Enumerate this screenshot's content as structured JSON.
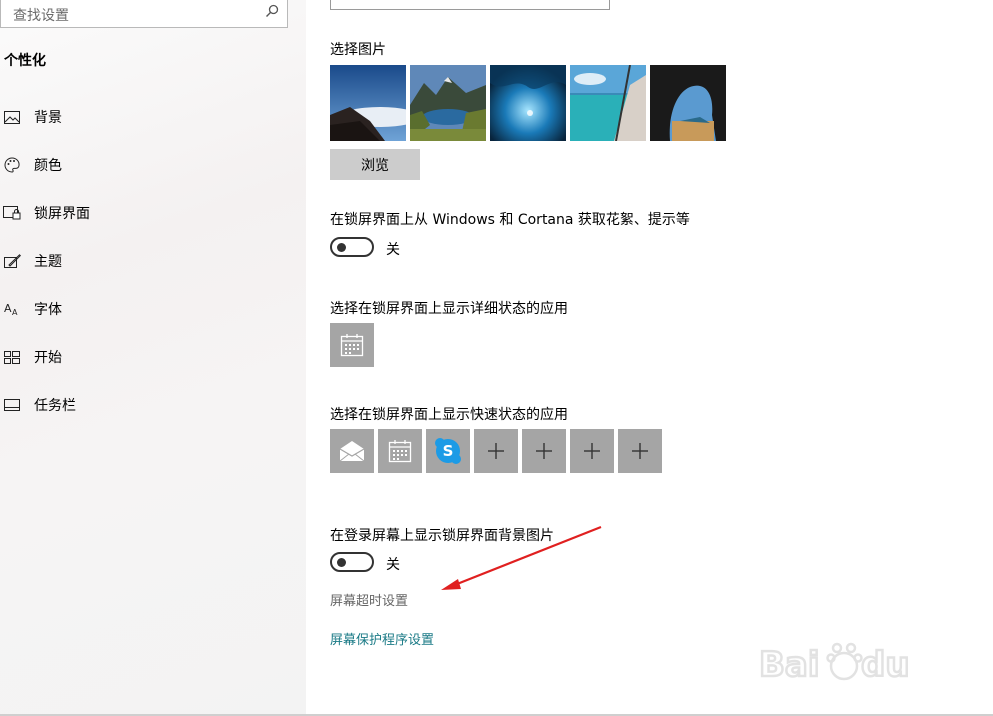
{
  "sidebar": {
    "search_placeholder": "查找设置",
    "section_title": "个性化",
    "items": [
      {
        "label": "背景",
        "icon": "picture-icon"
      },
      {
        "label": "颜色",
        "icon": "palette-icon"
      },
      {
        "label": "锁屏界面",
        "icon": "lock-screen-icon"
      },
      {
        "label": "主题",
        "icon": "theme-icon"
      },
      {
        "label": "字体",
        "icon": "font-icon"
      },
      {
        "label": "开始",
        "icon": "start-icon"
      },
      {
        "label": "任务栏",
        "icon": "taskbar-icon"
      }
    ]
  },
  "content": {
    "choose_picture_label": "选择图片",
    "browse_label": "浏览",
    "fun_facts_label": "在锁屏界面上从 Windows 和 Cortana 获取花絮、提示等",
    "fun_facts_toggle": "关",
    "detailed_status_label": "选择在锁屏界面上显示详细状态的应用",
    "quick_status_label": "选择在锁屏界面上显示快速状态的应用",
    "signin_bg_label": "在登录屏幕上显示锁屏界面背景图片",
    "signin_bg_toggle": "关",
    "screen_timeout_link": "屏幕超时设置",
    "screensaver_link": "屏幕保护程序设置"
  },
  "colors": {
    "accent_link": "#1a7a86",
    "tile_bg": "#a5a5a5",
    "arrow": "#e02020"
  }
}
